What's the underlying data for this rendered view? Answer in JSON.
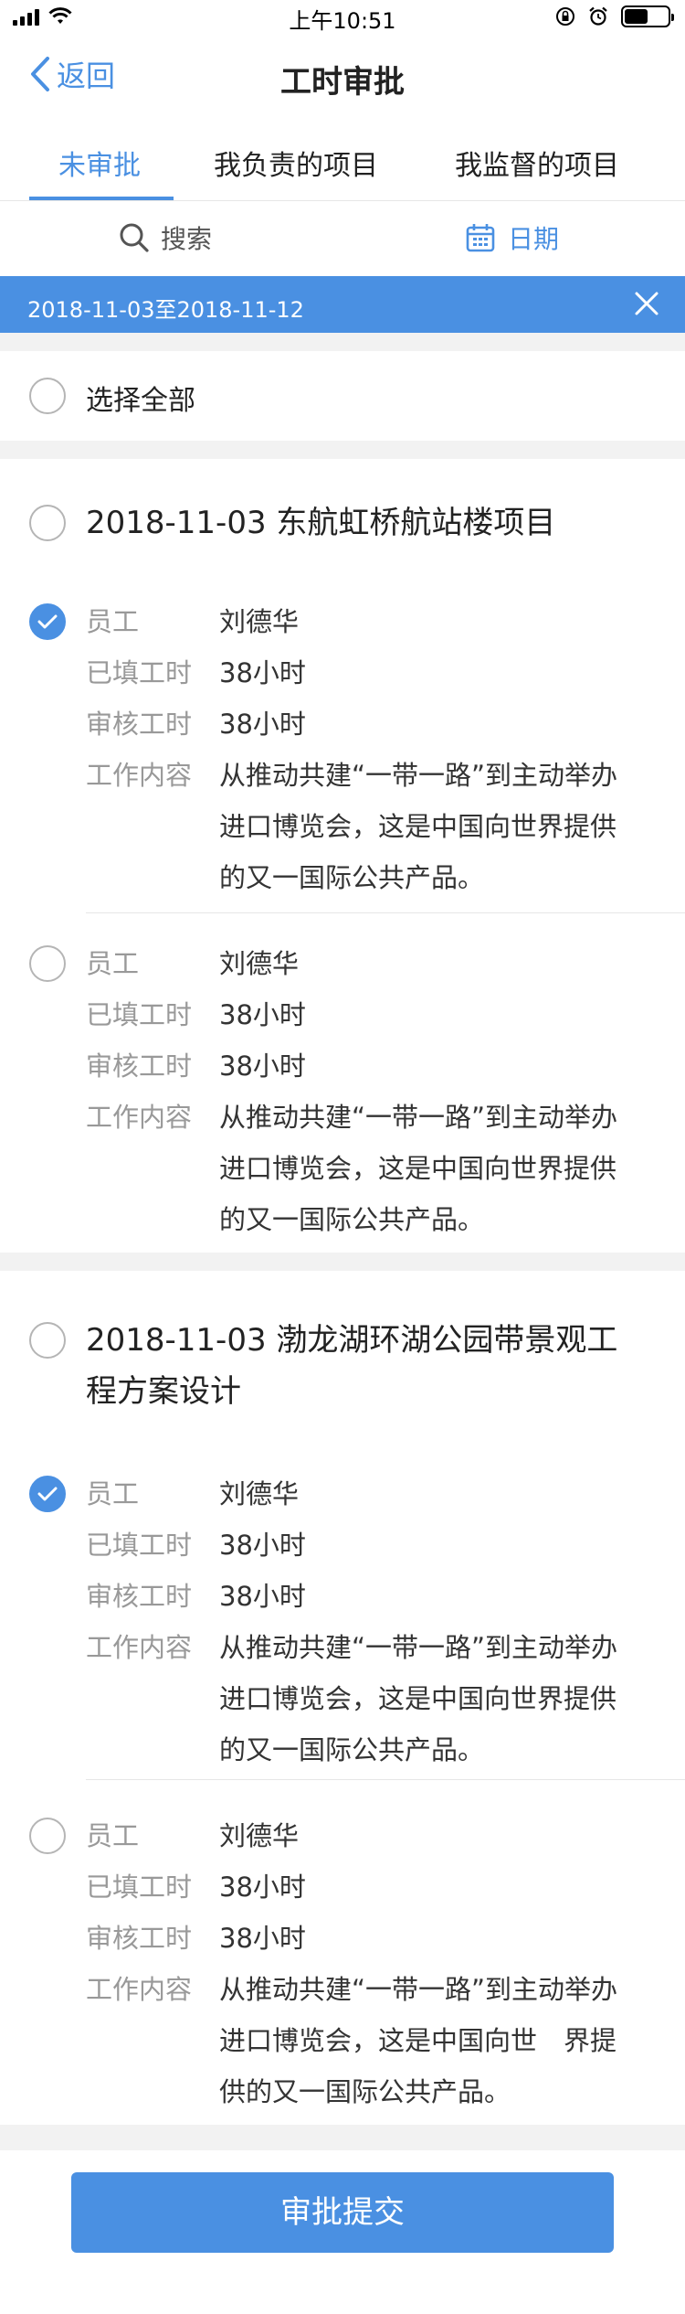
{
  "status": {
    "time": "上午10:51"
  },
  "nav": {
    "back_label": "返回",
    "title": "工时审批"
  },
  "tabs": [
    {
      "label": "未审批",
      "active": true
    },
    {
      "label": "我负责的项目",
      "active": false
    },
    {
      "label": "我监督的项目",
      "active": false
    }
  ],
  "filter": {
    "search_label": "搜索",
    "date_label": "日期"
  },
  "date_range": "2018-11-03至2018-11-12",
  "select_all_label": "选择全部",
  "field_labels": {
    "employee": "员工",
    "filled_hours": "已填工时",
    "reviewed_hours": "审核工时",
    "content": "工作内容"
  },
  "projects": [
    {
      "title": "2018-11-03 东航虹桥航站楼项目",
      "checked": false,
      "entries": [
        {
          "checked": true,
          "employee": "刘德华",
          "filled_hours": "38小时",
          "reviewed_hours": "38小时",
          "content_lines": [
            "从推动共建“一带一路”到主动举办",
            "进口博览会，这是中国向世界提供",
            "的又一国际公共产品。"
          ]
        },
        {
          "checked": false,
          "employee": "刘德华",
          "filled_hours": "38小时",
          "reviewed_hours": "38小时",
          "content_lines": [
            "从推动共建“一带一路”到主动举办",
            "进口博览会，这是中国向世界提供",
            "的又一国际公共产品。"
          ]
        }
      ]
    },
    {
      "title_lines": [
        "2018-11-03 渤龙湖环湖公园带景观工",
        "程方案设计"
      ],
      "checked": false,
      "entries": [
        {
          "checked": true,
          "employee": "刘德华",
          "filled_hours": "38小时",
          "reviewed_hours": "38小时",
          "content_lines": [
            "从推动共建“一带一路”到主动举办",
            "进口博览会，这是中国向世界提供",
            "的又一国际公共产品。"
          ]
        },
        {
          "checked": false,
          "employee": "刘德华",
          "filled_hours": "38小时",
          "reviewed_hours": "38小时",
          "content_lines": [
            "从推动共建“一带一路”到主动举办",
            "进口博览会，这是中国向世　界提",
            "供的又一国际公共产品。"
          ]
        }
      ]
    }
  ],
  "submit_label": "审批提交",
  "colors": {
    "accent": "#4a90e2",
    "muted": "#999999"
  }
}
